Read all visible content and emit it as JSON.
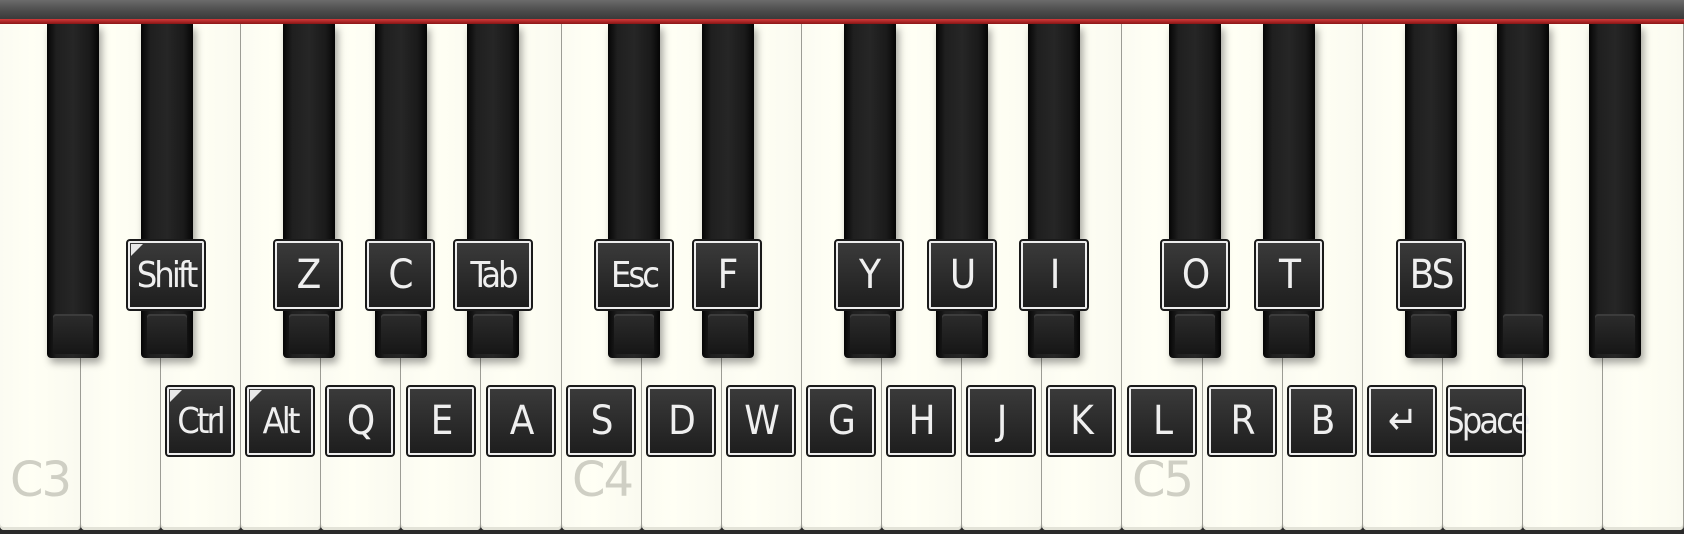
{
  "octave_labels": [
    "C3",
    "C4",
    "C5"
  ],
  "black_key_labels": [
    "Shift",
    "Z",
    "C",
    "Tab",
    "Esc",
    "F",
    "Y",
    "U",
    "I",
    "O",
    "T",
    "BS"
  ],
  "white_key_labels": [
    "Ctrl",
    "Alt",
    "Q",
    "E",
    "A",
    "S",
    "D",
    "W",
    "G",
    "H",
    "J",
    "K",
    "L",
    "R",
    "B",
    "↵",
    "Space"
  ],
  "modifier_labels": [
    "Shift",
    "Ctrl",
    "Alt"
  ],
  "colors": {
    "red_line": "#c02020",
    "white_key": "#fffff4",
    "black_key": "#1a1a1a",
    "label_bg": "#2a2a2a"
  }
}
